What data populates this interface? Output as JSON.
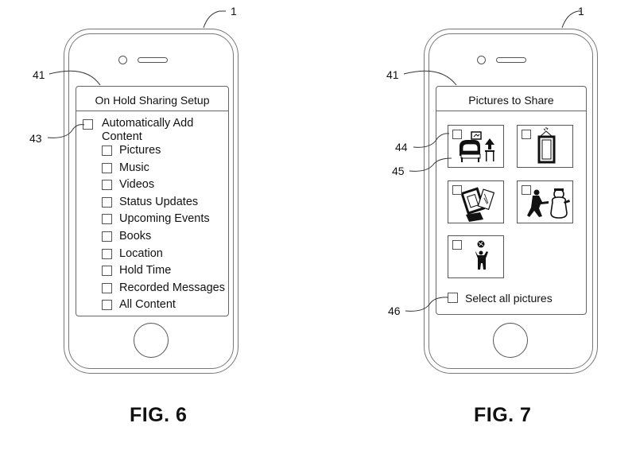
{
  "figures": [
    {
      "caption": "FIG. 6",
      "device_ref": "1",
      "screen_ref": "41",
      "screen": {
        "title": "On Hold Sharing Setup",
        "master_option": {
          "ref": "43",
          "label_line1": "Automatically Add",
          "label_line2": "Content",
          "checked": false
        },
        "options": [
          {
            "label": "Pictures",
            "checked": false
          },
          {
            "label": "Music",
            "checked": false
          },
          {
            "label": "Videos",
            "checked": false
          },
          {
            "label": "Status Updates",
            "checked": false
          },
          {
            "label": "Upcoming Events",
            "checked": false
          },
          {
            "label": "Books",
            "checked": false
          },
          {
            "label": "Location",
            "checked": false
          },
          {
            "label": "Hold Time",
            "checked": false
          },
          {
            "label": "Recorded Messages",
            "checked": false
          },
          {
            "label": "All Content",
            "checked": false
          }
        ]
      }
    },
    {
      "caption": "FIG. 7",
      "device_ref": "1",
      "screen_ref": "41",
      "screen": {
        "title": "Pictures to Share",
        "checkbox_ref": "44",
        "picture_ref": "45",
        "pictures": [
          {
            "icon": "living-room-armchair-lamp-icon",
            "checked": false
          },
          {
            "icon": "hanging-picture-frame-icon",
            "checked": false
          },
          {
            "icon": "photo-frames-stack-icon",
            "checked": false
          },
          {
            "icon": "person-building-snowman-icon",
            "checked": false
          },
          {
            "icon": "person-throwing-ball-icon",
            "checked": false
          }
        ],
        "select_all": {
          "ref": "46",
          "label": "Select all pictures",
          "checked": false
        }
      }
    }
  ]
}
